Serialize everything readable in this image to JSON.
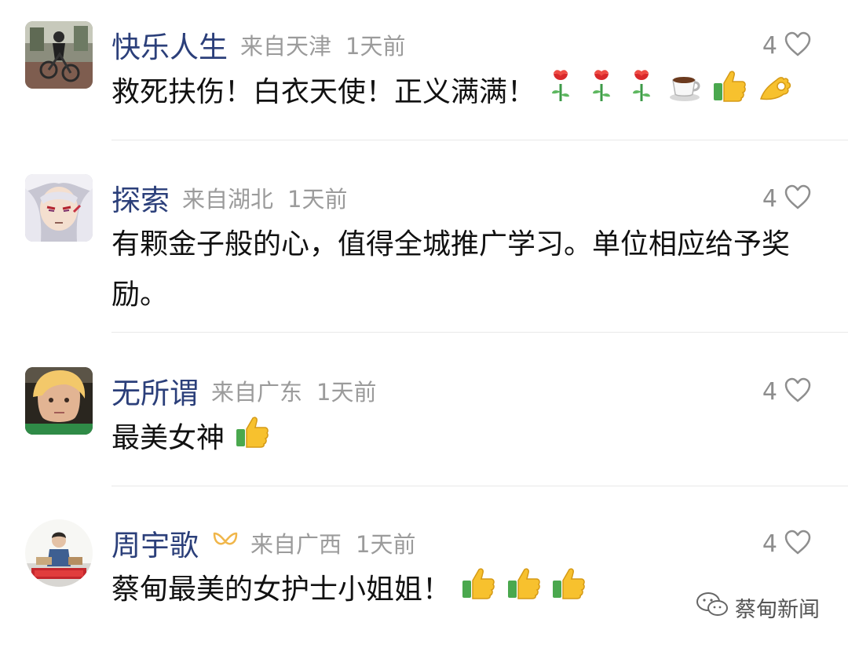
{
  "comments": [
    {
      "username": "快乐人生",
      "location": "来自天津",
      "time": "1天前",
      "likes": "4",
      "text": "救死扶伤！白衣天使！正义满满！",
      "emojis": [
        "rose-emoji",
        "rose-emoji",
        "rose-emoji",
        "coffee-emoji",
        "thumbs-up-emoji",
        "ok-hand-emoji"
      ]
    },
    {
      "username": "探索",
      "location": "来自湖北",
      "time": "1天前",
      "likes": "4",
      "text": "有颗金子般的心，值得全城推广学习。单位相应给予奖励。"
    },
    {
      "username": "无所谓",
      "location": "来自广东",
      "time": "1天前",
      "likes": "4",
      "text": "最美女神",
      "emojis": [
        "thumbs-up-emoji"
      ]
    },
    {
      "username": "周宇歌",
      "location": "来自广西",
      "time": "1天前",
      "likes": "4",
      "text": "蔡甸最美的女护士小姐姐！",
      "emojis": [
        "thumbs-up-emoji",
        "thumbs-up-emoji",
        "thumbs-up-emoji"
      ],
      "badge": "ribbon-badge-icon"
    }
  ],
  "watermark": {
    "label": "蔡甸新闻"
  },
  "colors": {
    "username": "#2b3f7a",
    "meta": "#9b9b9b",
    "divider": "#e8e8e8",
    "badge": "#f0b64a"
  }
}
